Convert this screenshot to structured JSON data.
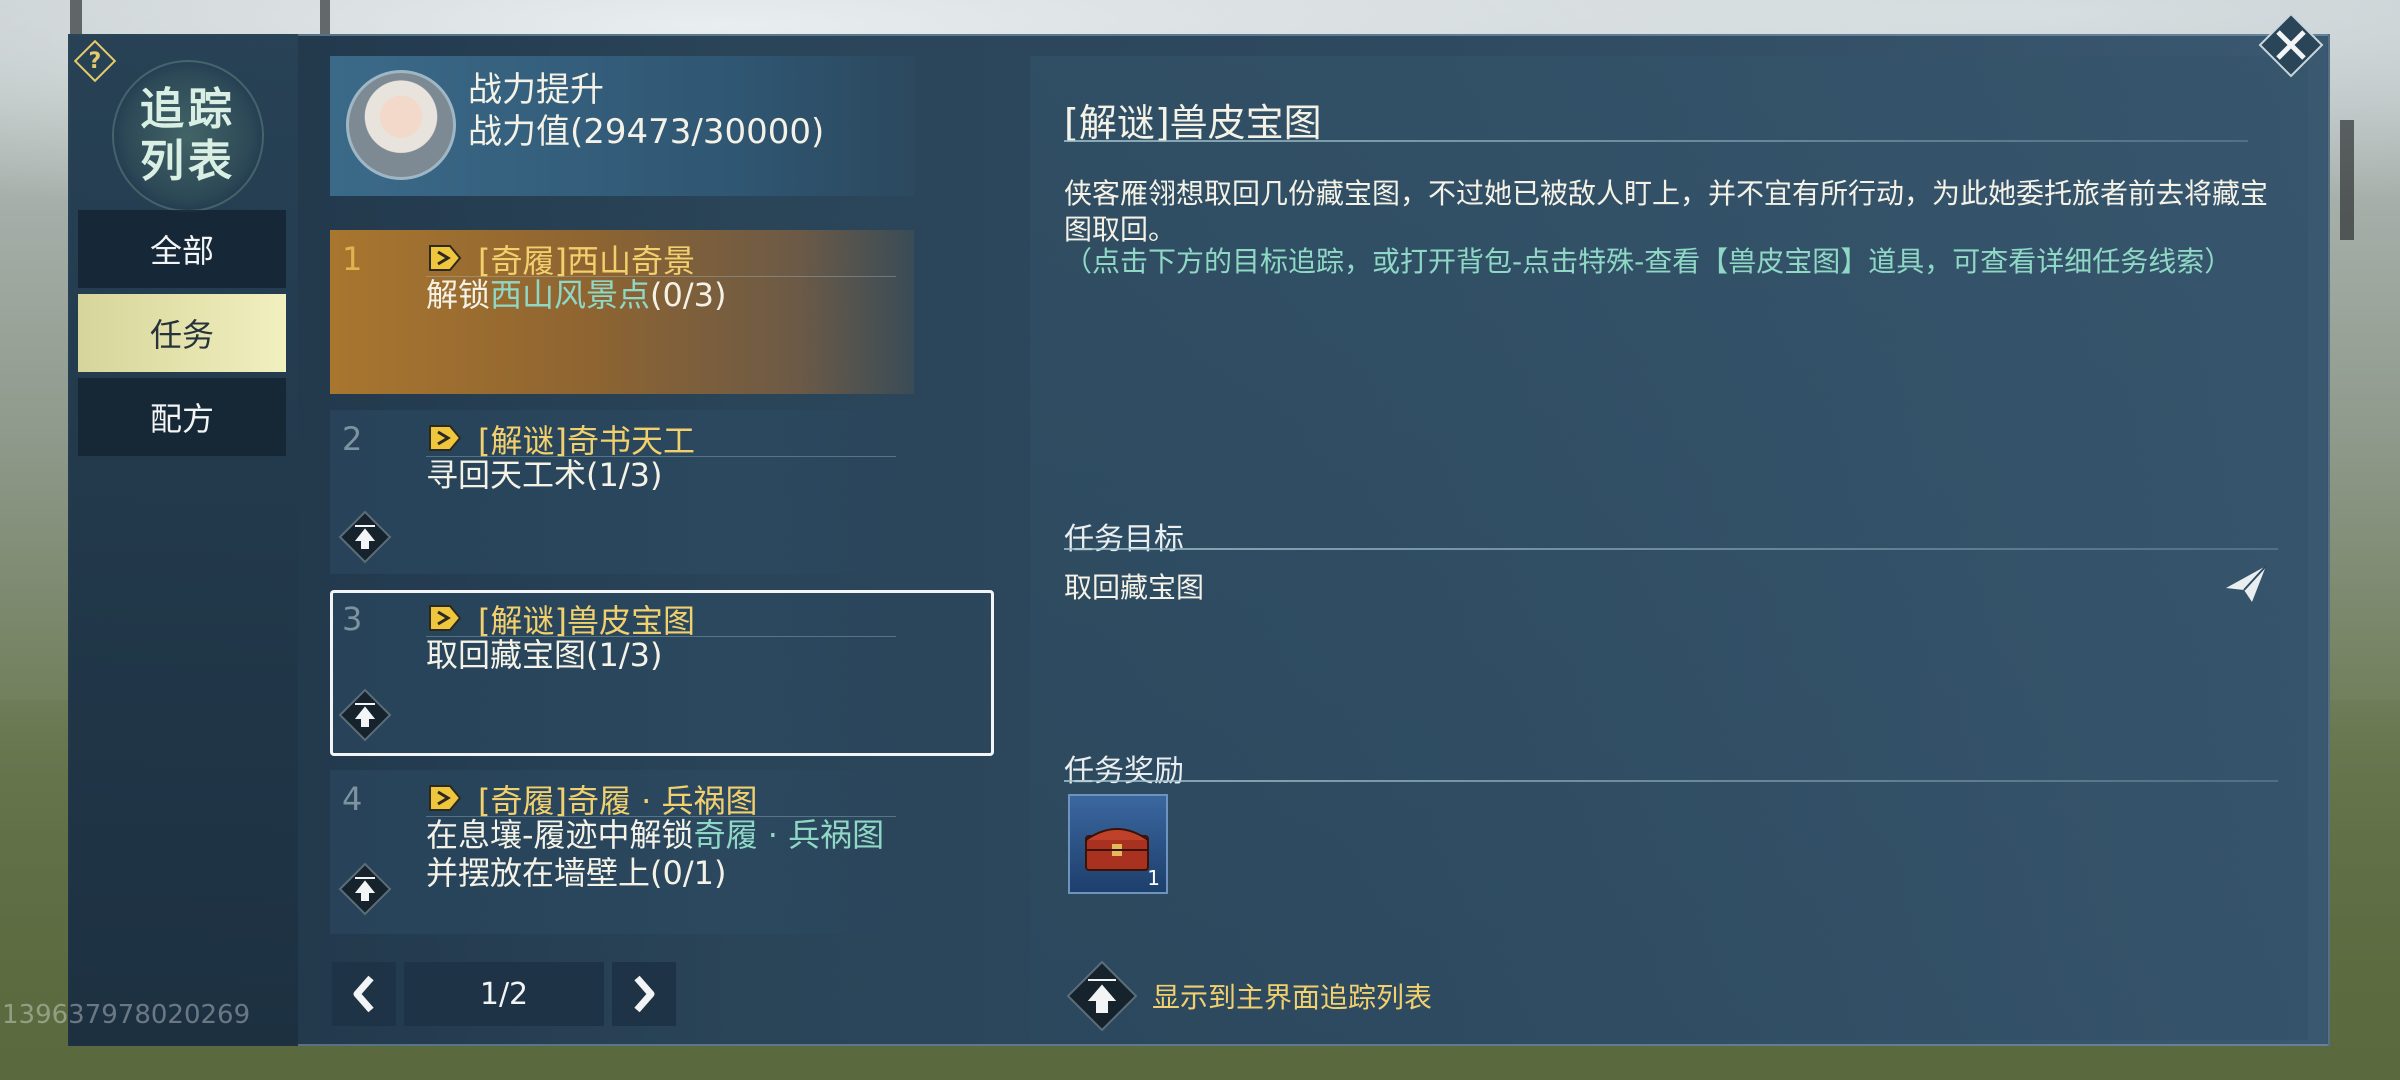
{
  "sidebar": {
    "help_symbol": "?",
    "emblem_text": "追踪列表",
    "items": [
      {
        "label": "全部",
        "active": false
      },
      {
        "label": "任务",
        "active": true
      },
      {
        "label": "配方",
        "active": false
      }
    ]
  },
  "power_card": {
    "title": "战力提升",
    "value_text": "战力值(29473/30000)"
  },
  "quests": [
    {
      "num": "1",
      "title": "[奇履]西山奇景",
      "desc_prefix": "解锁",
      "desc_highlight": "西山风景点",
      "desc_suffix": "(0/3)"
    },
    {
      "num": "2",
      "title": "[解谜]奇书天工",
      "desc": "寻回天工术(1/3)"
    },
    {
      "num": "3",
      "title": "[解谜]兽皮宝图",
      "desc": "取回藏宝图(1/3)"
    },
    {
      "num": "4",
      "title": "[奇履]奇履 · 兵祸图",
      "desc_prefix": "在息壤-履迹中解锁",
      "desc_highlight": "奇履 · 兵祸图",
      "desc_line2": "并摆放在墙壁上(0/1)"
    }
  ],
  "pager": {
    "text": "1/2"
  },
  "detail": {
    "title": "[解谜]兽皮宝图",
    "description": "侠客雁翎想取回几份藏宝图，不过她已被敌人盯上，并不宜有所行动，为此她委托旅者前去将藏宝图取回。",
    "hint": "（点击下方的目标追踪，或打开背包-点击特殊-查看【兽皮宝图】道具，可查看详细任务线索）",
    "goal_label": "任务目标",
    "goal_text": "取回藏宝图",
    "reward_label": "任务奖励",
    "reward_count": "1",
    "track_label": "显示到主界面追踪列表"
  },
  "watermark": "13963797802026​9",
  "colors": {
    "accent_gold": "#f1d06d",
    "highlight_teal": "#8fd8c5",
    "active_tab": "#e9e8b0"
  }
}
